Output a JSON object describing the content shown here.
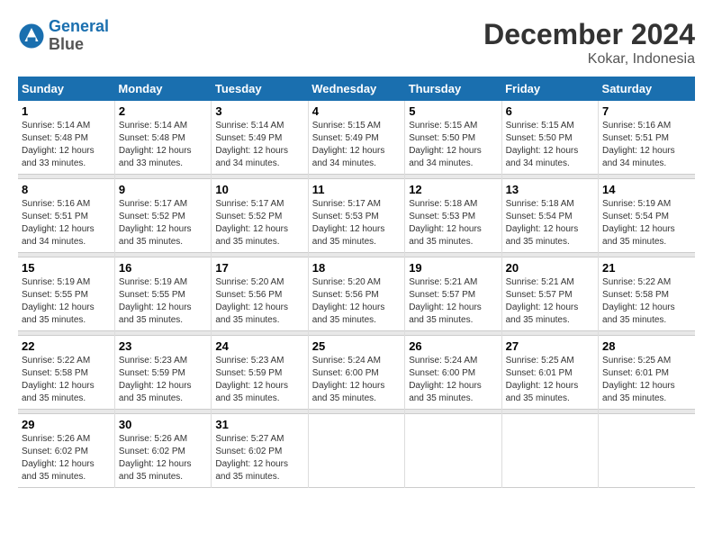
{
  "header": {
    "logo_line1": "General",
    "logo_line2": "Blue",
    "month_year": "December 2024",
    "location": "Kokar, Indonesia"
  },
  "weekdays": [
    "Sunday",
    "Monday",
    "Tuesday",
    "Wednesday",
    "Thursday",
    "Friday",
    "Saturday"
  ],
  "weeks": [
    [
      {
        "day": "1",
        "sunrise": "5:14 AM",
        "sunset": "5:48 PM",
        "daylight": "12 hours and 33 minutes."
      },
      {
        "day": "2",
        "sunrise": "5:14 AM",
        "sunset": "5:48 PM",
        "daylight": "12 hours and 33 minutes."
      },
      {
        "day": "3",
        "sunrise": "5:14 AM",
        "sunset": "5:49 PM",
        "daylight": "12 hours and 34 minutes."
      },
      {
        "day": "4",
        "sunrise": "5:15 AM",
        "sunset": "5:49 PM",
        "daylight": "12 hours and 34 minutes."
      },
      {
        "day": "5",
        "sunrise": "5:15 AM",
        "sunset": "5:50 PM",
        "daylight": "12 hours and 34 minutes."
      },
      {
        "day": "6",
        "sunrise": "5:15 AM",
        "sunset": "5:50 PM",
        "daylight": "12 hours and 34 minutes."
      },
      {
        "day": "7",
        "sunrise": "5:16 AM",
        "sunset": "5:51 PM",
        "daylight": "12 hours and 34 minutes."
      }
    ],
    [
      {
        "day": "8",
        "sunrise": "5:16 AM",
        "sunset": "5:51 PM",
        "daylight": "12 hours and 34 minutes."
      },
      {
        "day": "9",
        "sunrise": "5:17 AM",
        "sunset": "5:52 PM",
        "daylight": "12 hours and 35 minutes."
      },
      {
        "day": "10",
        "sunrise": "5:17 AM",
        "sunset": "5:52 PM",
        "daylight": "12 hours and 35 minutes."
      },
      {
        "day": "11",
        "sunrise": "5:17 AM",
        "sunset": "5:53 PM",
        "daylight": "12 hours and 35 minutes."
      },
      {
        "day": "12",
        "sunrise": "5:18 AM",
        "sunset": "5:53 PM",
        "daylight": "12 hours and 35 minutes."
      },
      {
        "day": "13",
        "sunrise": "5:18 AM",
        "sunset": "5:54 PM",
        "daylight": "12 hours and 35 minutes."
      },
      {
        "day": "14",
        "sunrise": "5:19 AM",
        "sunset": "5:54 PM",
        "daylight": "12 hours and 35 minutes."
      }
    ],
    [
      {
        "day": "15",
        "sunrise": "5:19 AM",
        "sunset": "5:55 PM",
        "daylight": "12 hours and 35 minutes."
      },
      {
        "day": "16",
        "sunrise": "5:19 AM",
        "sunset": "5:55 PM",
        "daylight": "12 hours and 35 minutes."
      },
      {
        "day": "17",
        "sunrise": "5:20 AM",
        "sunset": "5:56 PM",
        "daylight": "12 hours and 35 minutes."
      },
      {
        "day": "18",
        "sunrise": "5:20 AM",
        "sunset": "5:56 PM",
        "daylight": "12 hours and 35 minutes."
      },
      {
        "day": "19",
        "sunrise": "5:21 AM",
        "sunset": "5:57 PM",
        "daylight": "12 hours and 35 minutes."
      },
      {
        "day": "20",
        "sunrise": "5:21 AM",
        "sunset": "5:57 PM",
        "daylight": "12 hours and 35 minutes."
      },
      {
        "day": "21",
        "sunrise": "5:22 AM",
        "sunset": "5:58 PM",
        "daylight": "12 hours and 35 minutes."
      }
    ],
    [
      {
        "day": "22",
        "sunrise": "5:22 AM",
        "sunset": "5:58 PM",
        "daylight": "12 hours and 35 minutes."
      },
      {
        "day": "23",
        "sunrise": "5:23 AM",
        "sunset": "5:59 PM",
        "daylight": "12 hours and 35 minutes."
      },
      {
        "day": "24",
        "sunrise": "5:23 AM",
        "sunset": "5:59 PM",
        "daylight": "12 hours and 35 minutes."
      },
      {
        "day": "25",
        "sunrise": "5:24 AM",
        "sunset": "6:00 PM",
        "daylight": "12 hours and 35 minutes."
      },
      {
        "day": "26",
        "sunrise": "5:24 AM",
        "sunset": "6:00 PM",
        "daylight": "12 hours and 35 minutes."
      },
      {
        "day": "27",
        "sunrise": "5:25 AM",
        "sunset": "6:01 PM",
        "daylight": "12 hours and 35 minutes."
      },
      {
        "day": "28",
        "sunrise": "5:25 AM",
        "sunset": "6:01 PM",
        "daylight": "12 hours and 35 minutes."
      }
    ],
    [
      {
        "day": "29",
        "sunrise": "5:26 AM",
        "sunset": "6:02 PM",
        "daylight": "12 hours and 35 minutes."
      },
      {
        "day": "30",
        "sunrise": "5:26 AM",
        "sunset": "6:02 PM",
        "daylight": "12 hours and 35 minutes."
      },
      {
        "day": "31",
        "sunrise": "5:27 AM",
        "sunset": "6:02 PM",
        "daylight": "12 hours and 35 minutes."
      },
      null,
      null,
      null,
      null
    ]
  ]
}
